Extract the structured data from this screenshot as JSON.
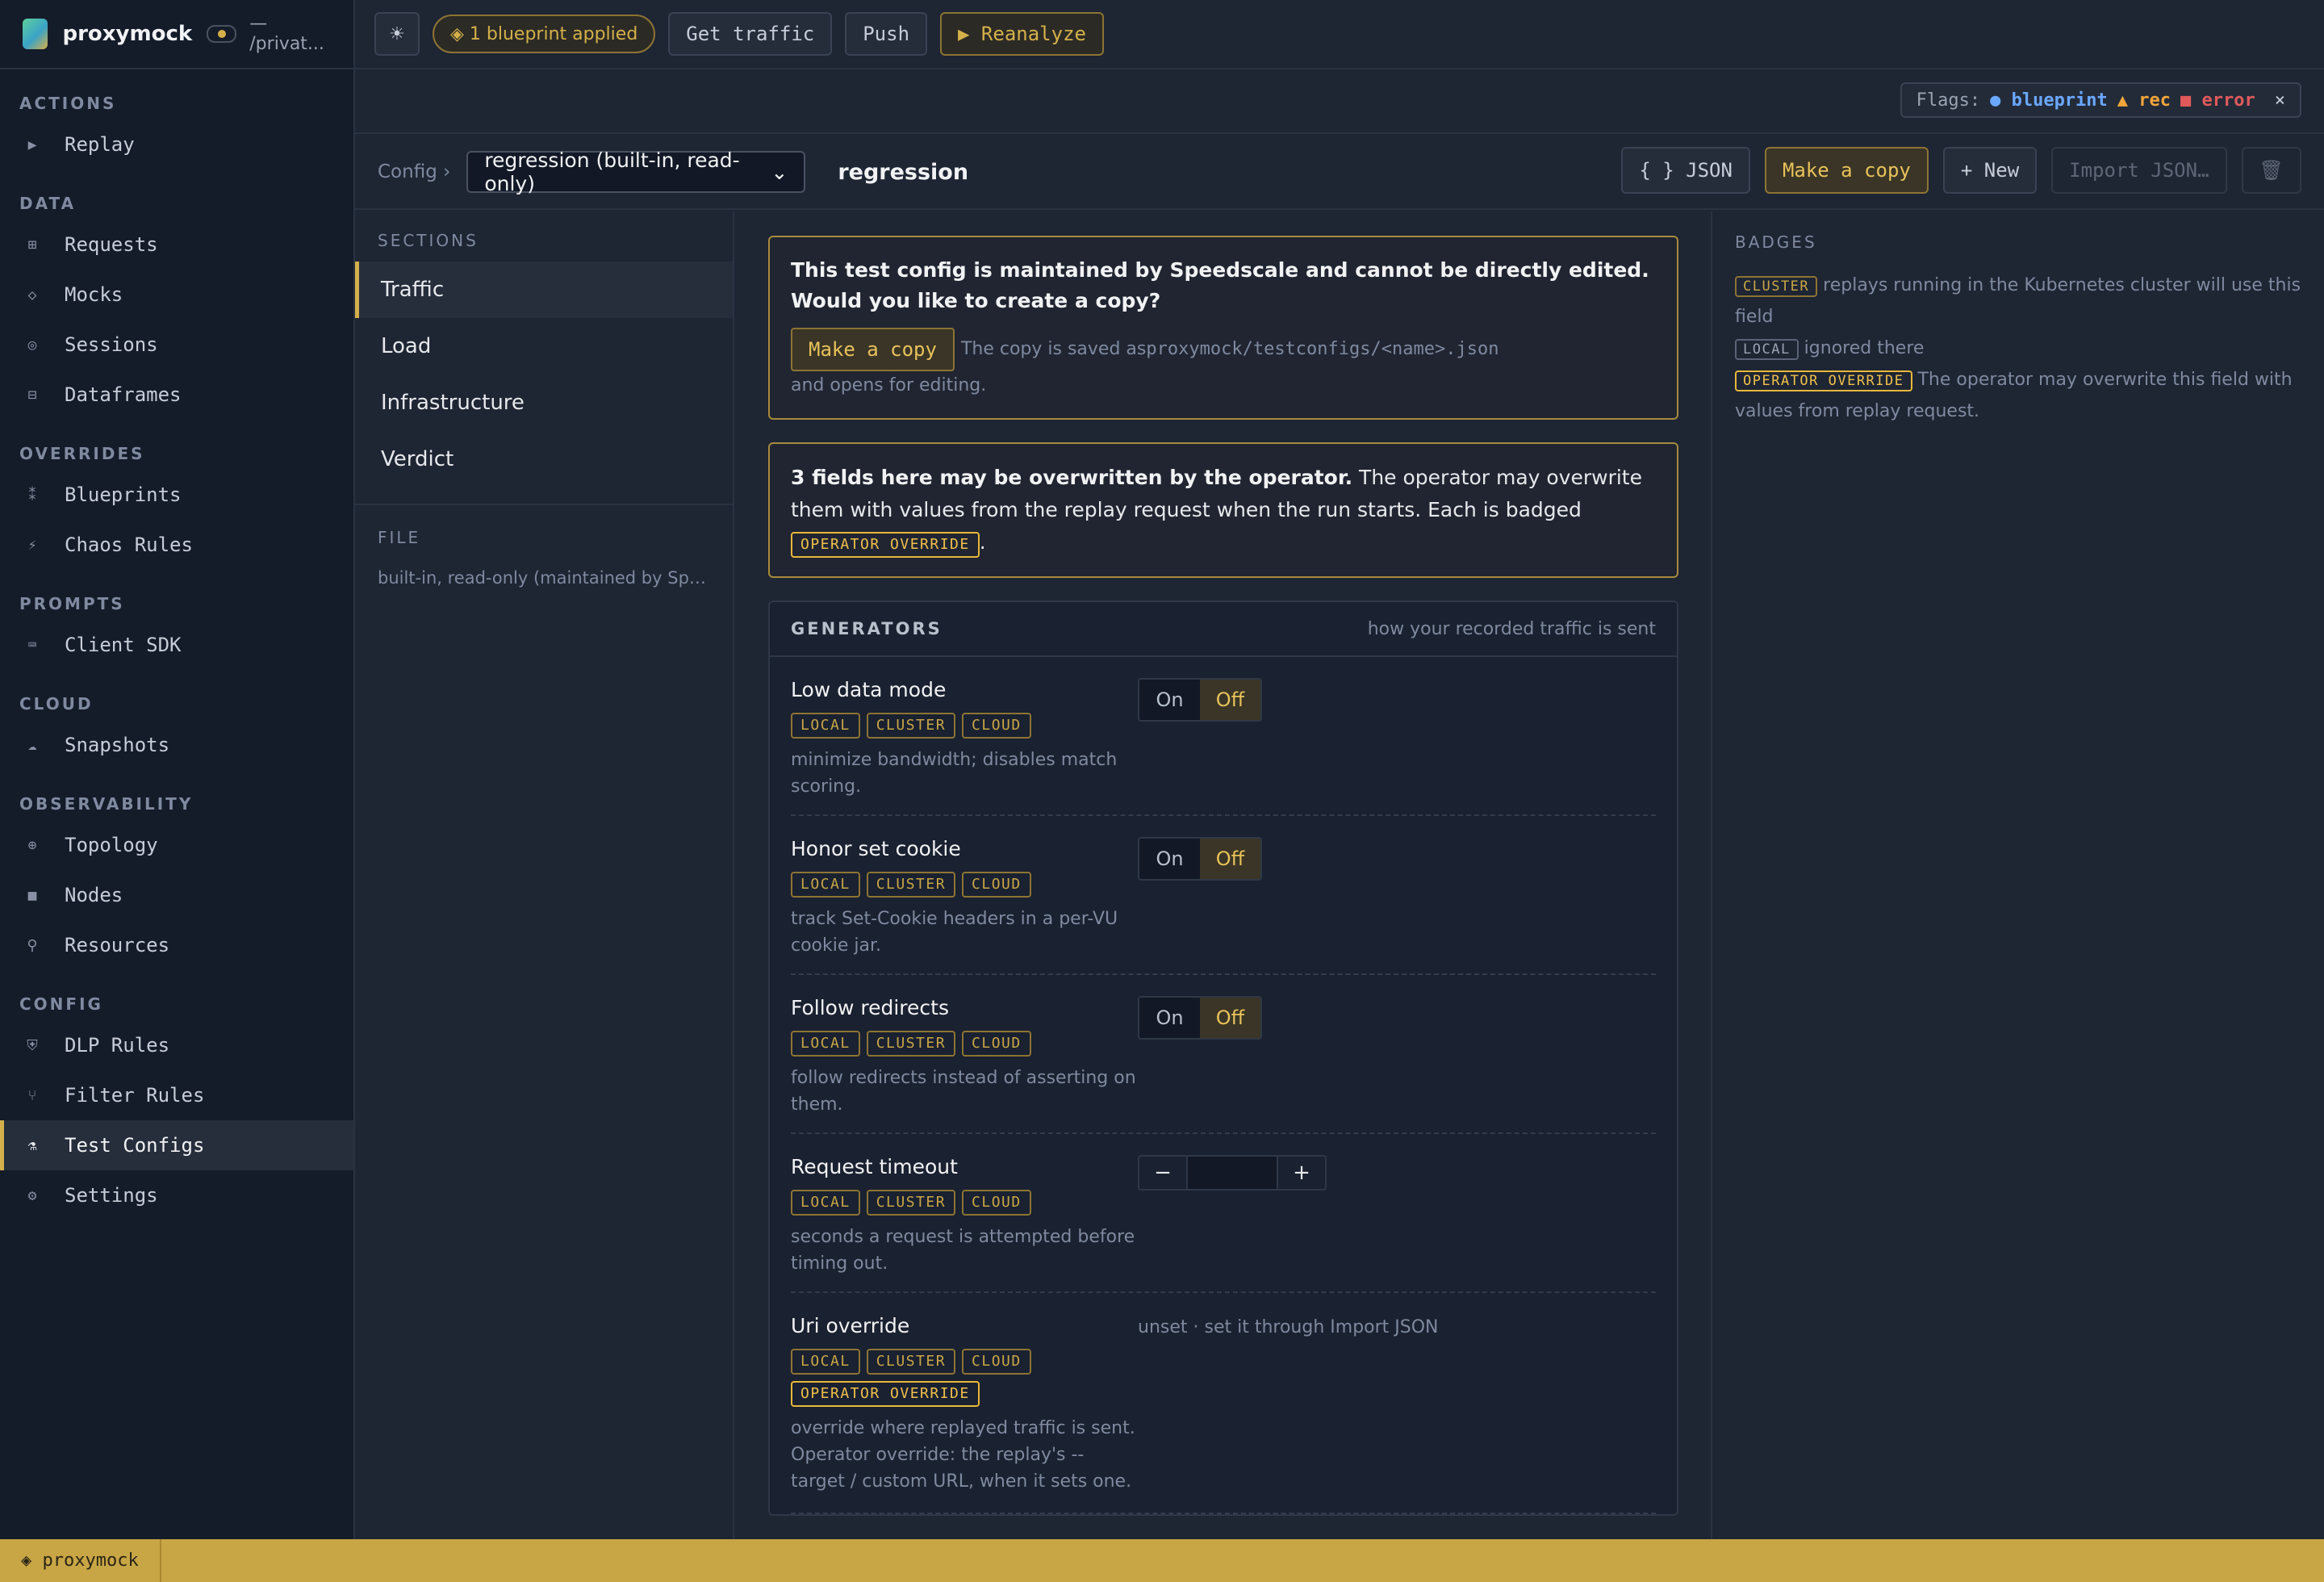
{
  "app": {
    "name": "proxymock",
    "path": "— /privat..."
  },
  "sidebar": {
    "sections": [
      {
        "title": "ACTIONS",
        "items": [
          {
            "label": "Replay",
            "icon": "play-icon",
            "glyph": "▶"
          }
        ]
      },
      {
        "title": "DATA",
        "items": [
          {
            "label": "Requests",
            "icon": "grid-icon",
            "glyph": "⊞"
          },
          {
            "label": "Mocks",
            "icon": "diamond-icon",
            "glyph": "◇"
          },
          {
            "label": "Sessions",
            "icon": "circle-dot-icon",
            "glyph": "◎"
          },
          {
            "label": "Dataframes",
            "icon": "table-icon",
            "glyph": "⊟"
          }
        ]
      },
      {
        "title": "OVERRIDES",
        "items": [
          {
            "label": "Blueprints",
            "icon": "blueprint-icon",
            "glyph": "⁑"
          },
          {
            "label": "Chaos Rules",
            "icon": "bolt-icon",
            "glyph": "⚡"
          }
        ]
      },
      {
        "title": "PROMPTS",
        "items": [
          {
            "label": "Client SDK",
            "icon": "keyboard-icon",
            "glyph": "⌨"
          }
        ]
      },
      {
        "title": "CLOUD",
        "items": [
          {
            "label": "Snapshots",
            "icon": "cloud-icon",
            "glyph": "☁"
          }
        ]
      },
      {
        "title": "OBSERVABILITY",
        "items": [
          {
            "label": "Topology",
            "icon": "topology-icon",
            "glyph": "⊕"
          },
          {
            "label": "Nodes",
            "icon": "node-icon",
            "glyph": "■"
          },
          {
            "label": "Resources",
            "icon": "wrench-icon",
            "glyph": "⚲"
          }
        ]
      },
      {
        "title": "CONFIG",
        "items": [
          {
            "label": "DLP Rules",
            "icon": "shield-icon",
            "glyph": "⛨"
          },
          {
            "label": "Filter Rules",
            "icon": "filter-icon",
            "glyph": "⑂"
          },
          {
            "label": "Test Configs",
            "icon": "flask-icon",
            "glyph": "⚗",
            "active": true
          },
          {
            "label": "Settings",
            "icon": "gear-icon",
            "glyph": "⚙"
          }
        ]
      }
    ]
  },
  "topbar": {
    "theme_glyph": "☀",
    "blueprint_pill": "◈ 1 blueprint applied",
    "get_traffic": "Get traffic",
    "push": "Push",
    "reanalyze": "▶ Reanalyze"
  },
  "flags": {
    "label": "Flags:",
    "blueprint": "● blueprint",
    "rec": "▲ rec",
    "error": "■ error",
    "close": "×"
  },
  "config": {
    "crumb": "Config ›",
    "selected": "regression (built-in, read-only)",
    "name": "regression",
    "json_btn": "{ } JSON",
    "copy_btn": "Make a copy",
    "new_btn": "+ New",
    "import_btn": "Import JSON…",
    "delete_glyph": "🗑"
  },
  "sections_panel": {
    "heading": "SECTIONS",
    "items": [
      "Traffic",
      "Load",
      "Infrastructure",
      "Verdict"
    ],
    "file_heading": "FILE",
    "file_text": "built-in, read-only (maintained by Speedscale)"
  },
  "notice": {
    "title": "This test config is maintained by Speedscale and cannot be directly edited. Would you like to create a copy?",
    "copy_btn": "Make a copy",
    "help_a": "The copy is saved as ",
    "help_path": "proxymock/testconfigs/<name>.json",
    "help_b": " and opens for editing."
  },
  "notice2": {
    "strong": "3 fields here may be overwritten by the operator.",
    "text": " The operator may overwrite them with values from the replay request when the run starts. Each is badged ",
    "badge": "OPERATOR OVERRIDE",
    "end": "."
  },
  "generators": {
    "title": "GENERATORS",
    "subtitle": "how your recorded traffic is sent",
    "badges": {
      "local": "LOCAL",
      "cluster": "CLUSTER",
      "cloud": "CLOUD",
      "operator": "OPERATOR OVERRIDE"
    },
    "toggle": {
      "on": "On",
      "off": "Off"
    },
    "stepper": {
      "minus": "−",
      "plus": "+"
    },
    "fields": [
      {
        "name": "Low data mode",
        "desc": "minimize bandwidth; disables match scoring.",
        "control": "toggle",
        "value": "Off"
      },
      {
        "name": "Honor set cookie",
        "desc": "track Set-Cookie headers in a per-VU cookie jar.",
        "control": "toggle",
        "value": "Off"
      },
      {
        "name": "Follow redirects",
        "desc": "follow redirects instead of asserting on them.",
        "control": "toggle",
        "value": "Off"
      },
      {
        "name": "Request timeout",
        "desc": "seconds a request is attempted before timing out.",
        "control": "stepper",
        "value": ""
      },
      {
        "name": "Uri override",
        "desc": "override where replayed traffic is sent. Operator override: the replay's --target / custom URL, when it sets one.",
        "control": "unset",
        "operator": true,
        "value": "unset · set it through Import JSON"
      }
    ]
  },
  "badges_panel": {
    "heading": "BADGES",
    "cluster_badge": "CLUSTER",
    "cluster_text": " replays running in the Kubernetes cluster will use this field",
    "local_badge": "LOCAL",
    "local_text": " ignored there",
    "op_badge": "OPERATOR OVERRIDE",
    "op_text": " The operator may overwrite this field with values from replay request."
  },
  "statusbar": {
    "label": "◈ proxymock"
  },
  "colors": {
    "accent": "#d4b04a",
    "background": "#1e2533",
    "sidebar": "#141b29",
    "flag_blue": "#6aa8ff",
    "flag_orange": "#f2a53a",
    "flag_red": "#e05a5a"
  }
}
